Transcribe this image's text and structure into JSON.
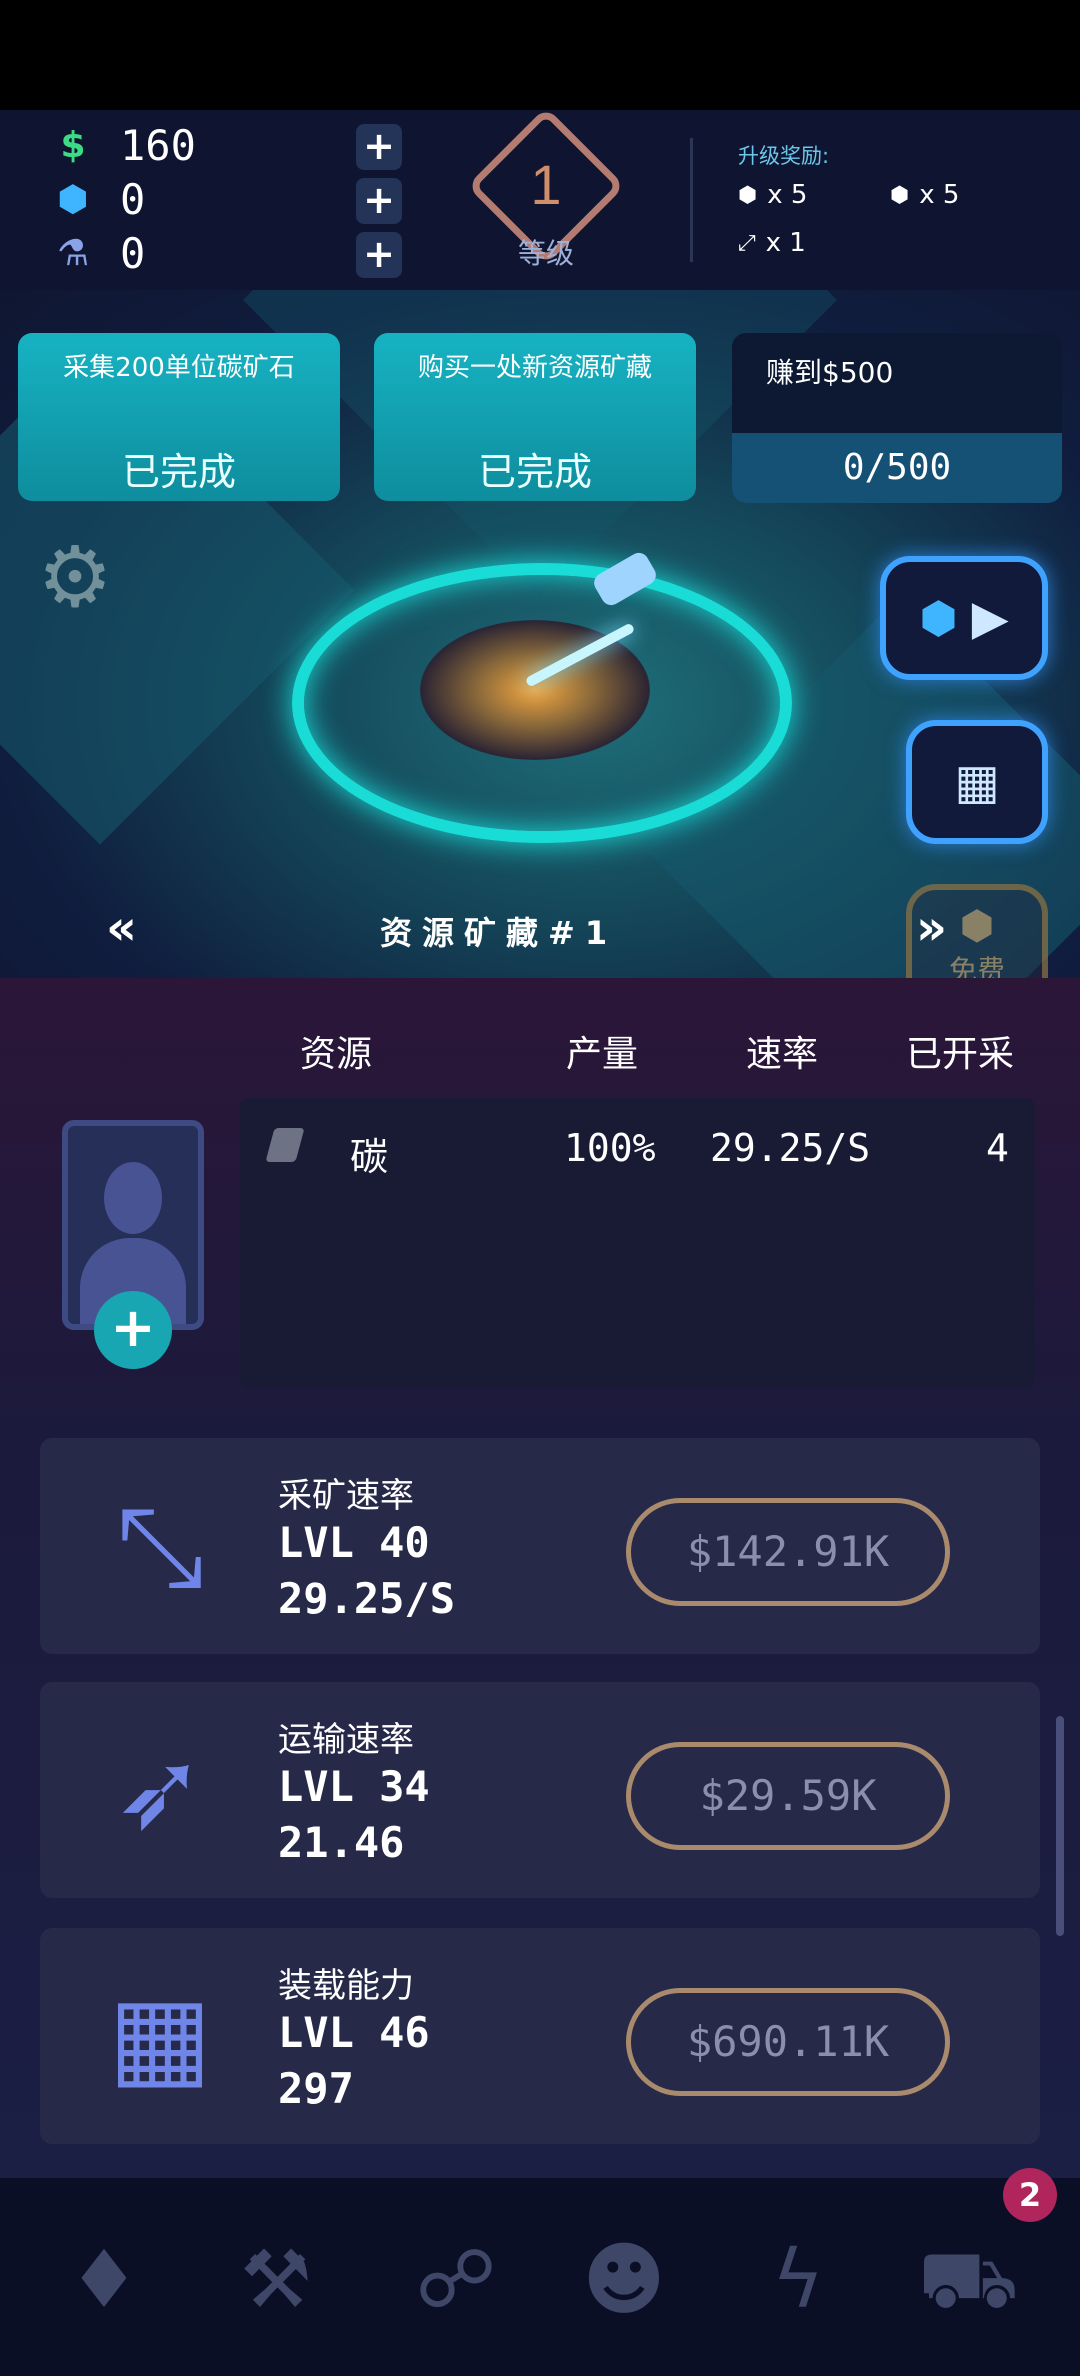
{
  "currencies": [
    {
      "icon": "dollar-icon",
      "symbol": "$",
      "value": "160",
      "color": "#3ddc84"
    },
    {
      "icon": "crystal-icon",
      "symbol": "⬢",
      "value": "0",
      "color": "#3fb5ff"
    },
    {
      "icon": "flask-icon",
      "symbol": "⚗",
      "value": "0",
      "color": "#8aa2e8"
    }
  ],
  "level": {
    "number": "1",
    "label": "等级"
  },
  "rewards": {
    "title": "升级奖励:",
    "items": [
      {
        "icon": "crystal-icon",
        "text": "x 5"
      },
      {
        "icon": "crystal-icon",
        "text": "x 5"
      },
      {
        "icon": "drill-icon",
        "text": "x 1"
      }
    ]
  },
  "quests": [
    {
      "title": "采集200单位碳矿石",
      "status": "已完成"
    },
    {
      "title": "购买一处新资源矿藏",
      "status": "已完成"
    },
    {
      "title": "赚到$500",
      "progress": "0/500"
    }
  ],
  "side_buttons": {
    "free_label": "免费"
  },
  "deposit": {
    "name": "资源矿藏#1",
    "prev": "«",
    "next": "»"
  },
  "table": {
    "headers": [
      "资源",
      "产量",
      "速率",
      "已开采"
    ],
    "rows": [
      {
        "resource": "碳",
        "yield": "100%",
        "rate": "29.25/S",
        "mined": "4"
      }
    ]
  },
  "upgrades": [
    {
      "title": "采矿速率",
      "level": "LVL 40",
      "value": "29.25/S",
      "price": "$142.91K",
      "icon": "mining-laser-icon"
    },
    {
      "title": "运输速率",
      "level": "LVL 34",
      "value": "21.46",
      "price": "$29.59K",
      "icon": "rocket-icon"
    },
    {
      "title": "装载能力",
      "level": "LVL 46",
      "value": "297",
      "price": "$690.11K",
      "icon": "cubes-icon"
    }
  ],
  "bottom_nav": {
    "items": [
      "gem-icon",
      "hammer-icon",
      "network-icon",
      "person-icon",
      "lightning-icon",
      "cart-icon"
    ],
    "cart_badge": "2"
  },
  "colors": {
    "accent": "#19dcd6",
    "button_border": "#3fa2ff",
    "price_border": "#a98a6d"
  }
}
